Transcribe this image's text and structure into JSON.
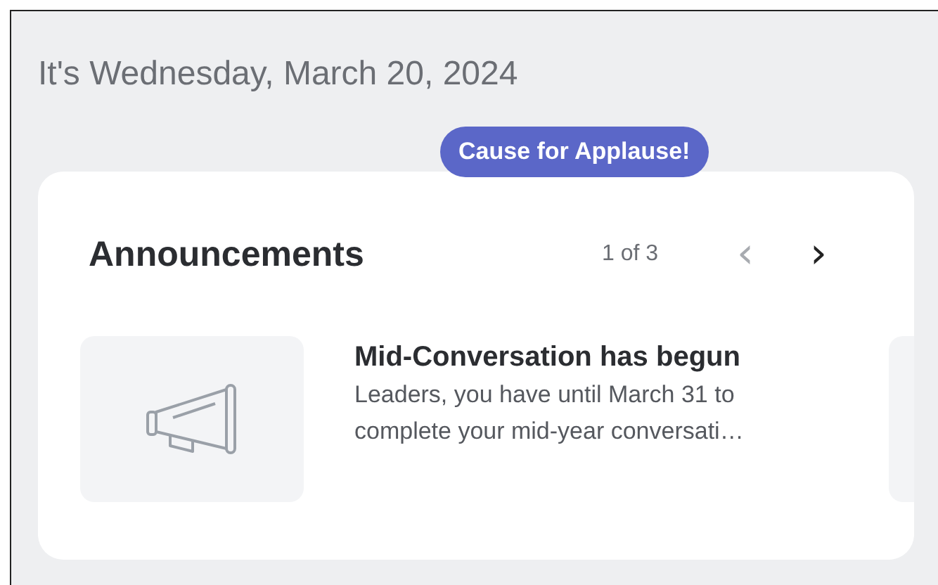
{
  "date_heading": "It's Wednesday, March 20, 2024",
  "badge": "Cause for Applause!",
  "announcements": {
    "title": "Announcements",
    "counter": "1 of 3",
    "pager": [
      {
        "icon": "‹",
        "disabled": true
      },
      {
        "icon": "›",
        "disabled": false
      }
    ],
    "items": [
      {
        "title": "Mid-Conversation has begun",
        "body": "Leaders, you have until March 31 to complete your mid-year conversati…"
      }
    ]
  }
}
